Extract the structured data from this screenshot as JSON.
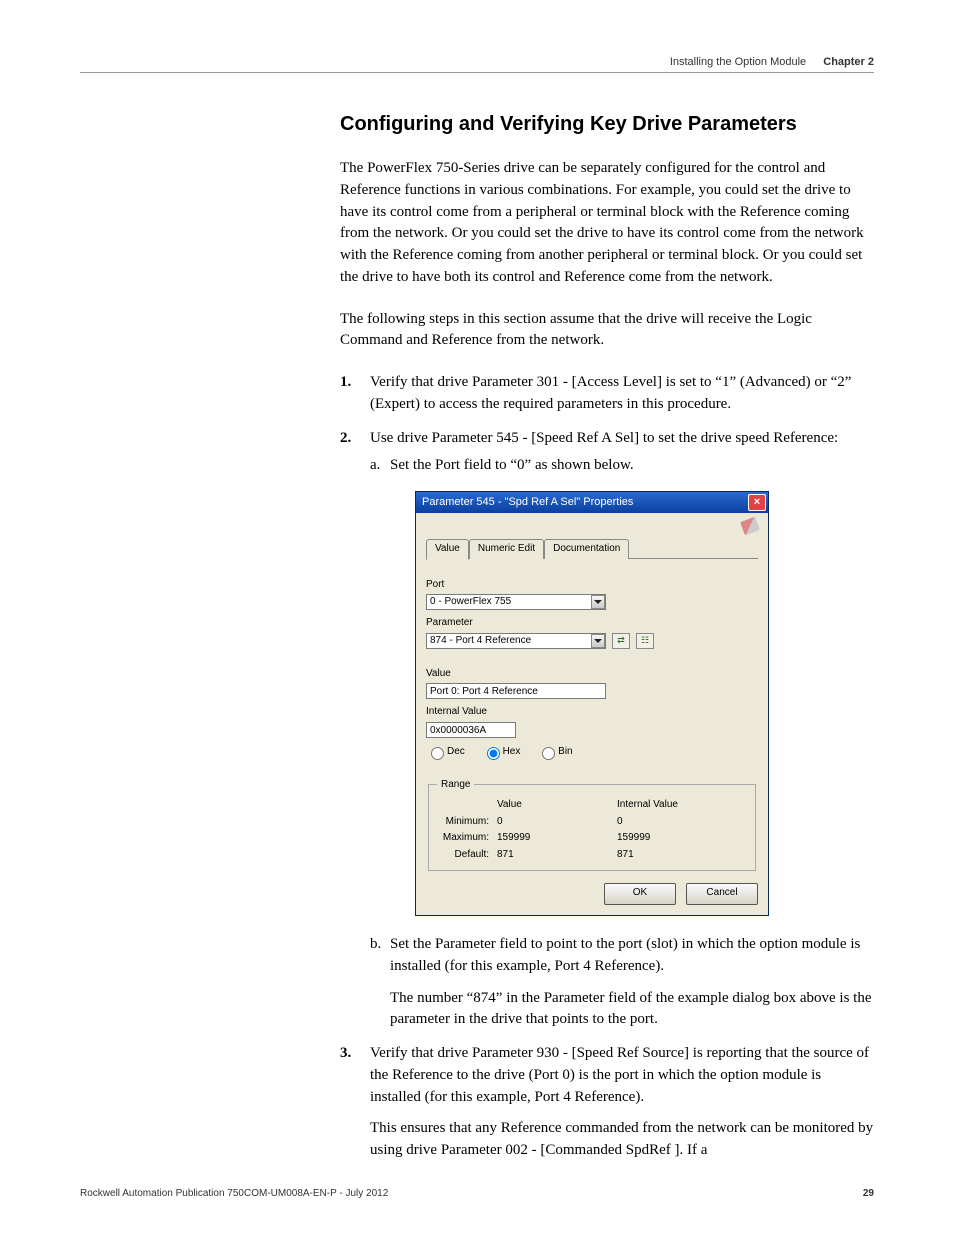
{
  "header": {
    "section_title_light": "Installing the Option Module",
    "chapter": "Chapter 2"
  },
  "section_heading": "Configuring and Verifying Key Drive Parameters",
  "para1": "The PowerFlex 750-Series drive can be separately configured for the control and Reference functions in various combinations. For example, you could set the drive to have its control come from a peripheral or terminal block with the Reference coming from the network. Or you could set the drive to have its control come from the network with the Reference coming from another peripheral or terminal block. Or you could set the drive to have both its control and Reference come from the network.",
  "para2": "The following steps in this section assume that the drive will receive the Logic Command and Reference from the network.",
  "steps": {
    "s1": "Verify that drive Parameter 301 - [Access Level] is set to “1” (Advanced) or “2” (Expert) to access the required parameters in this procedure.",
    "s2": "Use drive Parameter 545 - [Speed Ref A Sel] to set the drive speed Reference:",
    "s2a": "Set the Port field to “0” as shown below.",
    "s2b": "Set the Parameter field to point to the port (slot) in which the option module is installed (for this example, Port 4 Reference).",
    "s2b_note": "The number “874” in the Parameter field of the example dialog box above is the parameter in the drive that points to the port.",
    "s3": "Verify that drive Parameter 930 - [Speed Ref Source] is reporting that the source of the Reference to the drive (Port 0) is the port in which the option module is installed (for this example, Port 4 Reference).",
    "s3_note": "This ensures that any Reference commanded from the network can be monitored by using drive Parameter 002 - [Commanded SpdRef ]. If a"
  },
  "dialog": {
    "title": "Parameter 545 - \"Spd Ref A Sel\" Properties",
    "tabs": {
      "value": "Value",
      "numeric": "Numeric Edit",
      "doc": "Documentation"
    },
    "labels": {
      "port": "Port",
      "parameter": "Parameter",
      "value": "Value",
      "internal_value": "Internal Value"
    },
    "fields": {
      "port_value": "0 - PowerFlex 755",
      "parameter_value": "874 - Port 4 Reference",
      "value_text": "Port 0: Port 4 Reference",
      "internal_value_text": "0x0000036A"
    },
    "radios": {
      "dec": "Dec",
      "hex": "Hex",
      "bin": "Bin"
    },
    "range": {
      "legend": "Range",
      "col_value": "Value",
      "col_internal": "Internal Value",
      "rows": {
        "min_label": "Minimum:",
        "min_value": "0",
        "min_internal": "0",
        "max_label": "Maximum:",
        "max_value": "159999",
        "max_internal": "159999",
        "def_label": "Default:",
        "def_value": "871",
        "def_internal": "871"
      }
    },
    "buttons": {
      "ok": "OK",
      "cancel": "Cancel"
    }
  },
  "footer": {
    "pub": "Rockwell Automation Publication 750COM-UM008A-EN-P - July 2012",
    "page": "29"
  }
}
